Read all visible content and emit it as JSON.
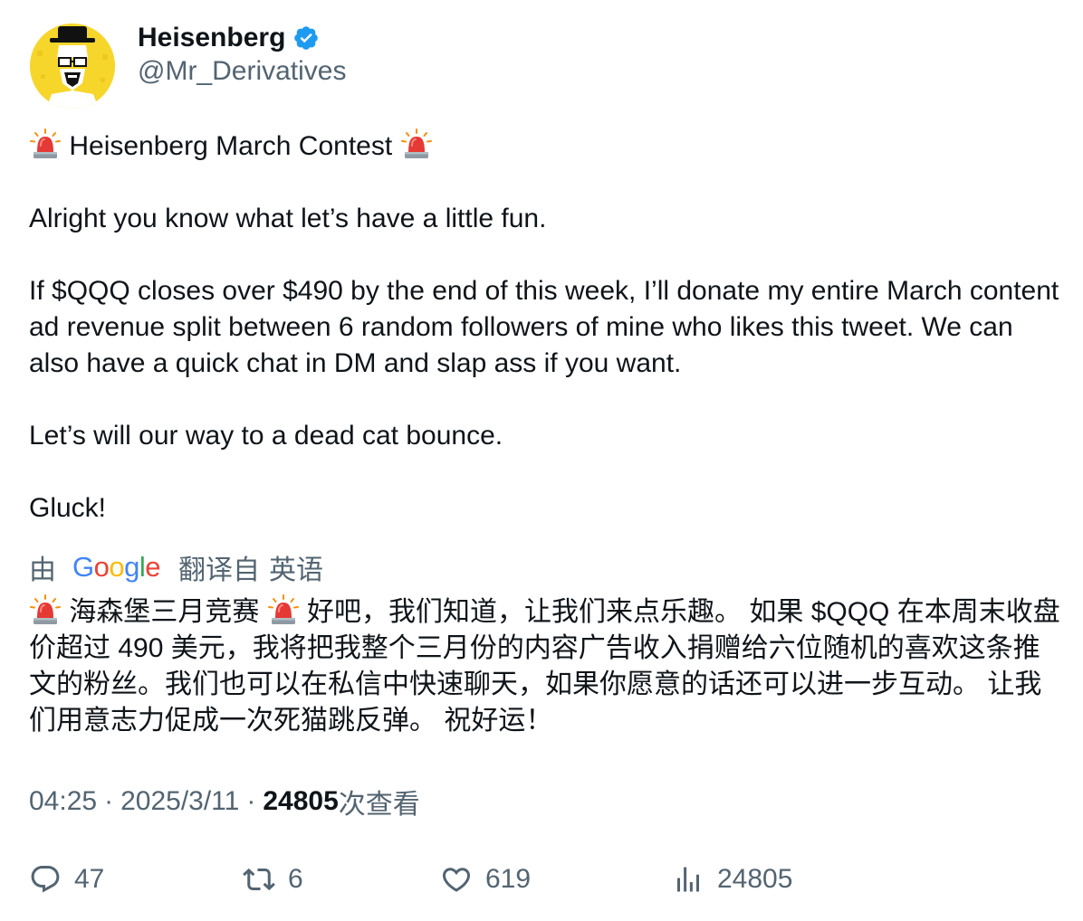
{
  "author": {
    "display_name": "Heisenberg",
    "handle": "@Mr_Derivatives",
    "verified_icon": "verified-badge-icon",
    "avatar_icon": "heisenberg-avatar"
  },
  "tweet": {
    "line1": "Heisenberg March Contest",
    "line2": "Alright you know what let’s have a little fun.",
    "line3": "If $QQQ closes over $490 by the end of this week, I’ll donate my entire March content ad revenue split between 6 random followers of mine who likes this tweet. We can also have a quick chat in DM and slap ass if you want.",
    "line4": "Let’s will our way to a dead cat bounce.",
    "line5": "Gluck!",
    "emoji_icon": "siren-icon"
  },
  "translation": {
    "by": "由",
    "google_G": "G",
    "google_o1": "o",
    "google_o2": "o",
    "google_g": "g",
    "google_l": "l",
    "google_e": "e",
    "translated_from": "翻译自",
    "language": "英语",
    "title": "海森堡三月竞赛",
    "text": "好吧，我们知道，让我们来点乐趣。 如果 $QQQ 在本周末收盘价超过 490 美元，我将把我整个三月份的内容广告收入捐赠给六位随机的喜欢这条推文的粉丝。我们也可以在私信中快速聊天，如果你愿意的话还可以进一步互动。 让我们用意志力促成一次死猫跳反弹。 祝好运！"
  },
  "meta": {
    "time": "04:25",
    "separator": "·",
    "date": "2025/3/11",
    "views": "24805",
    "views_label": "次查看"
  },
  "actions": {
    "replies": "47",
    "retweets": "6",
    "likes": "619",
    "views": "24805"
  },
  "colors": {
    "text": "#0f1419",
    "secondary": "#536471",
    "verified": "#1d9bf0",
    "google_blue": "#4285F4",
    "google_red": "#EA4335",
    "google_yellow": "#FBBC05",
    "google_green": "#34A853",
    "siren_red": "#e53935"
  }
}
